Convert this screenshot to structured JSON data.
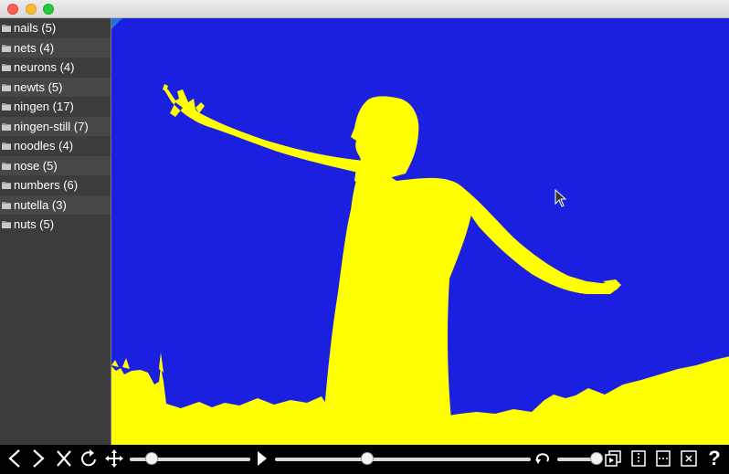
{
  "window": {
    "buttons": [
      "close",
      "minimize",
      "maximize"
    ]
  },
  "sidebar": {
    "items": [
      {
        "label": "nails (5)"
      },
      {
        "label": "nets (4)"
      },
      {
        "label": "neurons (4)"
      },
      {
        "label": "newts (5)"
      },
      {
        "label": "ningen (17)"
      },
      {
        "label": "ningen-still (7)"
      },
      {
        "label": "noodles (4)"
      },
      {
        "label": "nose (5)"
      },
      {
        "label": "numbers (6)"
      },
      {
        "label": "nutella (3)"
      },
      {
        "label": "nuts (5)"
      }
    ]
  },
  "viewer": {
    "colors": {
      "background": "#1b1fe0",
      "figure": "#ffff00"
    }
  },
  "toolbar": {
    "prev_glyph": "<",
    "next_glyph": ">",
    "close_glyph": "✕",
    "rotate_glyph": "↻",
    "move_glyph": "✥",
    "help_glyph": "?",
    "zoom_slider_fraction": 0.18,
    "timeline_slider_fraction": 0.36,
    "speed_slider_fraction": 0.9
  }
}
